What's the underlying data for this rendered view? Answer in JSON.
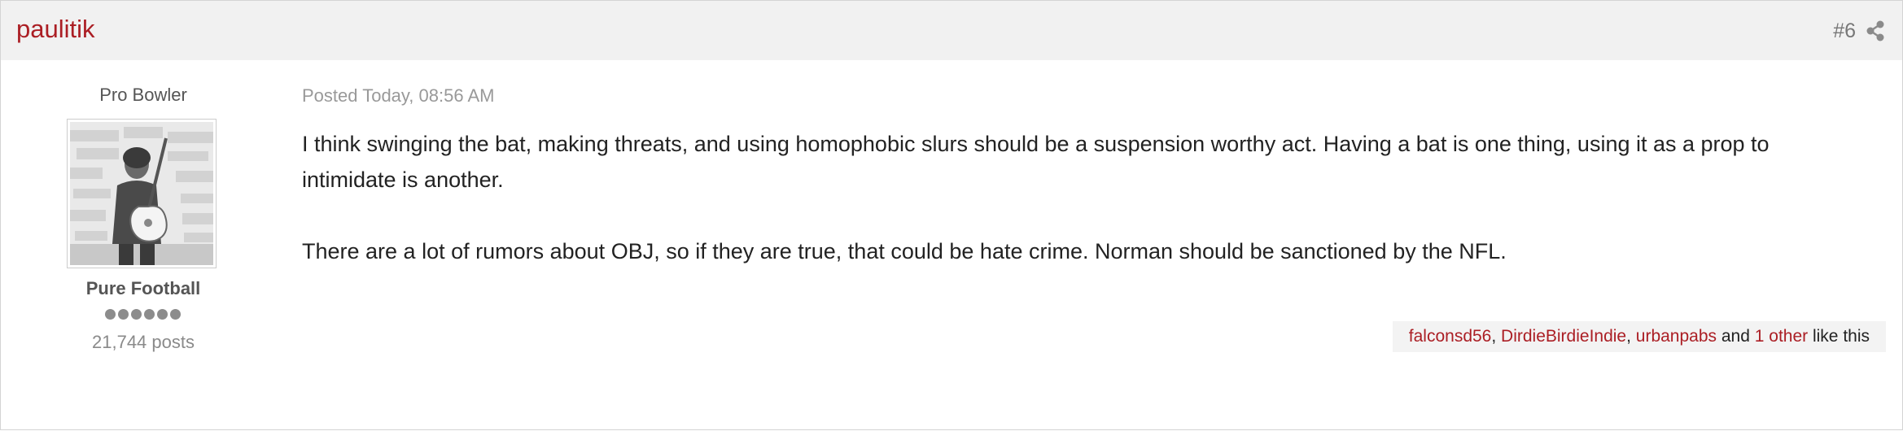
{
  "post": {
    "author": "paulitik",
    "number": "#6",
    "date": "Posted Today, 08:56 AM",
    "paragraphs": [
      "I think swinging the bat, making threats, and using homophobic slurs should be a suspension worthy act. Having a bat is one thing, using it as a prop to intimidate is another.",
      "There are a lot of rumors about OBJ, so if they are true, that could be hate crime. Norman should be sanctioned by the NFL."
    ]
  },
  "author_info": {
    "title": "Pro Bowler",
    "group": "Pure Football",
    "posts": "21,744 posts",
    "rank_pips": 6
  },
  "likes": {
    "users": [
      "falconsd56",
      "DirdieBirdieIndie",
      "urbanpabs"
    ],
    "sep_comma": ", ",
    "and_text": " and ",
    "other_link": "1 other",
    "suffix": " like this"
  },
  "icons": {
    "share": "share-icon",
    "avatar": "avatar-photo"
  },
  "colors": {
    "accent": "#ab1e24",
    "header_bg": "#f1f1f1",
    "likes_bg": "#f3f3f3"
  }
}
